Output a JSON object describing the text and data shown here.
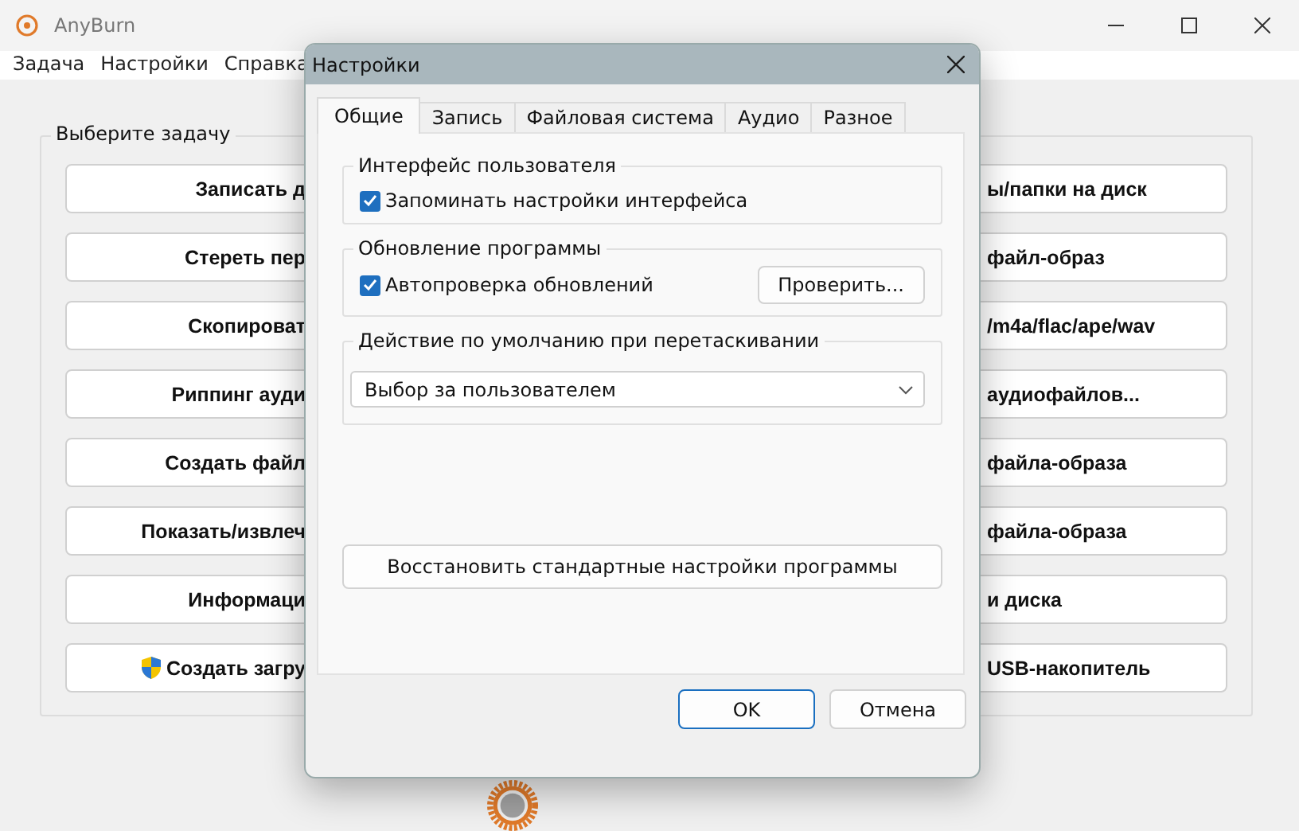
{
  "window": {
    "title": "AnyBurn"
  },
  "menu": [
    "Задача",
    "Настройки",
    "Справка"
  ],
  "task_group": {
    "title": "Выберите задачу",
    "buttons": [
      {
        "kind": "plain",
        "left_text": "Записать д",
        "right_text": "ы/папки на диск"
      },
      {
        "kind": "plain",
        "left_text": "Стереть пер",
        "right_text": "файл-образ"
      },
      {
        "kind": "plain",
        "left_text": "Скопироват",
        "right_text": "/m4a/flac/ape/wav"
      },
      {
        "kind": "plain",
        "left_text": "Риппинг ауди",
        "right_text": "аудиофайлов..."
      },
      {
        "kind": "plain",
        "left_text": "Создать файл",
        "right_text": "файла-образа"
      },
      {
        "kind": "plain",
        "left_text": "Показать/извлеч",
        "right_text": "файла-образа"
      },
      {
        "kind": "plain",
        "left_text": "Информаци",
        "right_text": "и диска"
      },
      {
        "kind": "elevated",
        "left_text": "Создать загру",
        "right_text": "USB-накопитель"
      }
    ]
  },
  "dialog": {
    "title": "Настройки",
    "tabs": [
      {
        "label": "Общие",
        "selected": true
      },
      {
        "label": "Запись",
        "selected": false
      },
      {
        "label": "Файловая система",
        "selected": false
      },
      {
        "label": "Аудио",
        "selected": false
      },
      {
        "label": "Разное",
        "selected": false
      }
    ],
    "groups": [
      {
        "kind": "checkbox",
        "title": "Интерфейс пользователя",
        "checkbox": {
          "label": "Запоминать настройки интерфейса",
          "checked": true
        }
      },
      {
        "kind": "checkbox",
        "title": "Обновление программы",
        "checkbox": {
          "label": "Автопроверка обновлений",
          "checked": true
        },
        "button": "Проверить..."
      },
      {
        "kind": "dropdown",
        "title": "Действие по умолчанию при перетаскивании",
        "value": "Выбор за пользователем"
      }
    ],
    "reset_button": "Восстановить стандартные настройки программы",
    "buttons": [
      {
        "label": "OK",
        "default": true
      },
      {
        "label": "Отмена",
        "default": false
      }
    ]
  }
}
